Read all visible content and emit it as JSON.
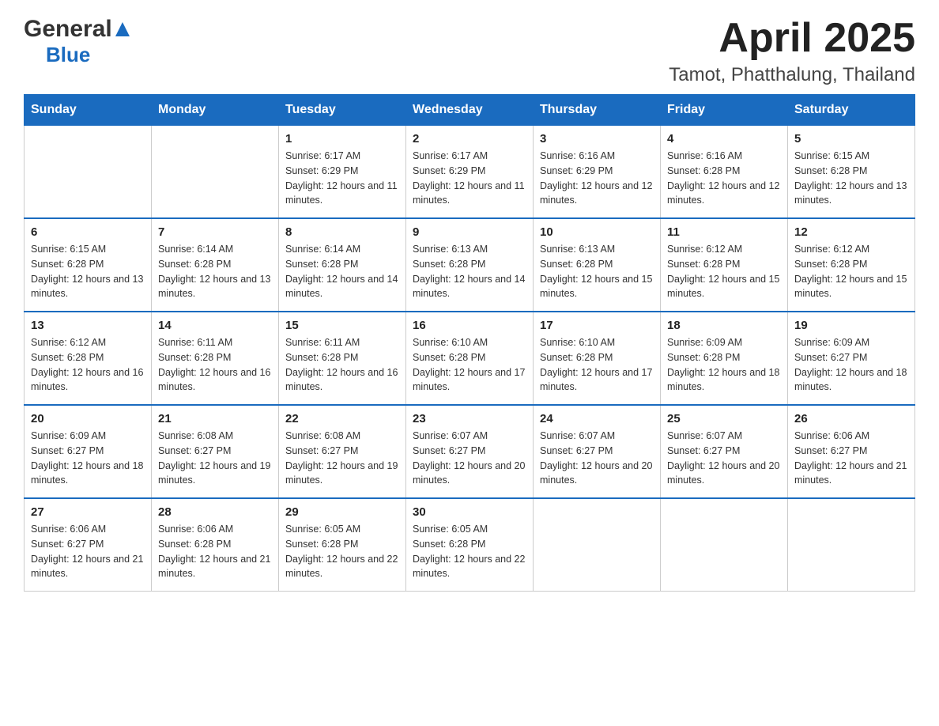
{
  "header": {
    "logo_general": "General",
    "logo_blue": "Blue",
    "title": "April 2025",
    "subtitle": "Tamot, Phatthalung, Thailand"
  },
  "calendar": {
    "days_of_week": [
      "Sunday",
      "Monday",
      "Tuesday",
      "Wednesday",
      "Thursday",
      "Friday",
      "Saturday"
    ],
    "weeks": [
      [
        {
          "day": "",
          "sunrise": "",
          "sunset": "",
          "daylight": ""
        },
        {
          "day": "",
          "sunrise": "",
          "sunset": "",
          "daylight": ""
        },
        {
          "day": "1",
          "sunrise": "Sunrise: 6:17 AM",
          "sunset": "Sunset: 6:29 PM",
          "daylight": "Daylight: 12 hours and 11 minutes."
        },
        {
          "day": "2",
          "sunrise": "Sunrise: 6:17 AM",
          "sunset": "Sunset: 6:29 PM",
          "daylight": "Daylight: 12 hours and 11 minutes."
        },
        {
          "day": "3",
          "sunrise": "Sunrise: 6:16 AM",
          "sunset": "Sunset: 6:29 PM",
          "daylight": "Daylight: 12 hours and 12 minutes."
        },
        {
          "day": "4",
          "sunrise": "Sunrise: 6:16 AM",
          "sunset": "Sunset: 6:28 PM",
          "daylight": "Daylight: 12 hours and 12 minutes."
        },
        {
          "day": "5",
          "sunrise": "Sunrise: 6:15 AM",
          "sunset": "Sunset: 6:28 PM",
          "daylight": "Daylight: 12 hours and 13 minutes."
        }
      ],
      [
        {
          "day": "6",
          "sunrise": "Sunrise: 6:15 AM",
          "sunset": "Sunset: 6:28 PM",
          "daylight": "Daylight: 12 hours and 13 minutes."
        },
        {
          "day": "7",
          "sunrise": "Sunrise: 6:14 AM",
          "sunset": "Sunset: 6:28 PM",
          "daylight": "Daylight: 12 hours and 13 minutes."
        },
        {
          "day": "8",
          "sunrise": "Sunrise: 6:14 AM",
          "sunset": "Sunset: 6:28 PM",
          "daylight": "Daylight: 12 hours and 14 minutes."
        },
        {
          "day": "9",
          "sunrise": "Sunrise: 6:13 AM",
          "sunset": "Sunset: 6:28 PM",
          "daylight": "Daylight: 12 hours and 14 minutes."
        },
        {
          "day": "10",
          "sunrise": "Sunrise: 6:13 AM",
          "sunset": "Sunset: 6:28 PM",
          "daylight": "Daylight: 12 hours and 15 minutes."
        },
        {
          "day": "11",
          "sunrise": "Sunrise: 6:12 AM",
          "sunset": "Sunset: 6:28 PM",
          "daylight": "Daylight: 12 hours and 15 minutes."
        },
        {
          "day": "12",
          "sunrise": "Sunrise: 6:12 AM",
          "sunset": "Sunset: 6:28 PM",
          "daylight": "Daylight: 12 hours and 15 minutes."
        }
      ],
      [
        {
          "day": "13",
          "sunrise": "Sunrise: 6:12 AM",
          "sunset": "Sunset: 6:28 PM",
          "daylight": "Daylight: 12 hours and 16 minutes."
        },
        {
          "day": "14",
          "sunrise": "Sunrise: 6:11 AM",
          "sunset": "Sunset: 6:28 PM",
          "daylight": "Daylight: 12 hours and 16 minutes."
        },
        {
          "day": "15",
          "sunrise": "Sunrise: 6:11 AM",
          "sunset": "Sunset: 6:28 PM",
          "daylight": "Daylight: 12 hours and 16 minutes."
        },
        {
          "day": "16",
          "sunrise": "Sunrise: 6:10 AM",
          "sunset": "Sunset: 6:28 PM",
          "daylight": "Daylight: 12 hours and 17 minutes."
        },
        {
          "day": "17",
          "sunrise": "Sunrise: 6:10 AM",
          "sunset": "Sunset: 6:28 PM",
          "daylight": "Daylight: 12 hours and 17 minutes."
        },
        {
          "day": "18",
          "sunrise": "Sunrise: 6:09 AM",
          "sunset": "Sunset: 6:28 PM",
          "daylight": "Daylight: 12 hours and 18 minutes."
        },
        {
          "day": "19",
          "sunrise": "Sunrise: 6:09 AM",
          "sunset": "Sunset: 6:27 PM",
          "daylight": "Daylight: 12 hours and 18 minutes."
        }
      ],
      [
        {
          "day": "20",
          "sunrise": "Sunrise: 6:09 AM",
          "sunset": "Sunset: 6:27 PM",
          "daylight": "Daylight: 12 hours and 18 minutes."
        },
        {
          "day": "21",
          "sunrise": "Sunrise: 6:08 AM",
          "sunset": "Sunset: 6:27 PM",
          "daylight": "Daylight: 12 hours and 19 minutes."
        },
        {
          "day": "22",
          "sunrise": "Sunrise: 6:08 AM",
          "sunset": "Sunset: 6:27 PM",
          "daylight": "Daylight: 12 hours and 19 minutes."
        },
        {
          "day": "23",
          "sunrise": "Sunrise: 6:07 AM",
          "sunset": "Sunset: 6:27 PM",
          "daylight": "Daylight: 12 hours and 20 minutes."
        },
        {
          "day": "24",
          "sunrise": "Sunrise: 6:07 AM",
          "sunset": "Sunset: 6:27 PM",
          "daylight": "Daylight: 12 hours and 20 minutes."
        },
        {
          "day": "25",
          "sunrise": "Sunrise: 6:07 AM",
          "sunset": "Sunset: 6:27 PM",
          "daylight": "Daylight: 12 hours and 20 minutes."
        },
        {
          "day": "26",
          "sunrise": "Sunrise: 6:06 AM",
          "sunset": "Sunset: 6:27 PM",
          "daylight": "Daylight: 12 hours and 21 minutes."
        }
      ],
      [
        {
          "day": "27",
          "sunrise": "Sunrise: 6:06 AM",
          "sunset": "Sunset: 6:27 PM",
          "daylight": "Daylight: 12 hours and 21 minutes."
        },
        {
          "day": "28",
          "sunrise": "Sunrise: 6:06 AM",
          "sunset": "Sunset: 6:28 PM",
          "daylight": "Daylight: 12 hours and 21 minutes."
        },
        {
          "day": "29",
          "sunrise": "Sunrise: 6:05 AM",
          "sunset": "Sunset: 6:28 PM",
          "daylight": "Daylight: 12 hours and 22 minutes."
        },
        {
          "day": "30",
          "sunrise": "Sunrise: 6:05 AM",
          "sunset": "Sunset: 6:28 PM",
          "daylight": "Daylight: 12 hours and 22 minutes."
        },
        {
          "day": "",
          "sunrise": "",
          "sunset": "",
          "daylight": ""
        },
        {
          "day": "",
          "sunrise": "",
          "sunset": "",
          "daylight": ""
        },
        {
          "day": "",
          "sunrise": "",
          "sunset": "",
          "daylight": ""
        }
      ]
    ]
  }
}
